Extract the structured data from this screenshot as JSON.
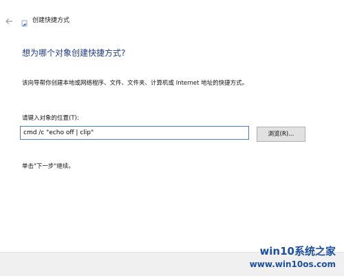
{
  "window": {
    "title": "创建快捷方式"
  },
  "page": {
    "heading": "想为哪个对象创建快捷方式?",
    "description": "该向导帮你创建本地或网络程序、文件、文件夹、计算机或 Internet 地址的快捷方式。",
    "location_label": "请键入对象的位置(T):",
    "location_value": "cmd /c \"echo off | clip\"",
    "browse_label": "浏览(R)...",
    "hint": "单击\"下一步\"继续。"
  },
  "watermark": {
    "line1": "win10系统之家",
    "line2": "www.win10os.com"
  },
  "icons": {
    "back": "back-arrow-icon",
    "app": "shortcut-wizard-icon"
  }
}
